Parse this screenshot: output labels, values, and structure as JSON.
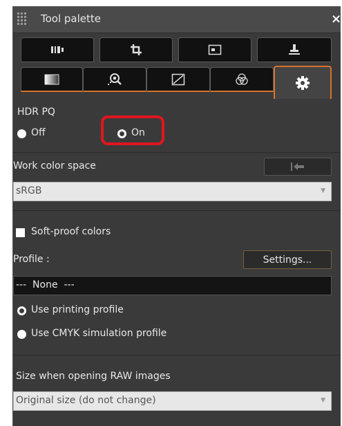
{
  "window": {
    "title": "Tool palette",
    "close_glyph": "×"
  },
  "tabs_row1": [
    {
      "icon": "histogram-panel-icon"
    },
    {
      "icon": "crop-icon"
    },
    {
      "icon": "image-view-icon"
    },
    {
      "icon": "stamp-icon"
    }
  ],
  "tabs_row2": [
    {
      "icon": "brightness-icon"
    },
    {
      "icon": "zoom-detail-icon"
    },
    {
      "icon": "tone-curve-icon"
    },
    {
      "icon": "color-circles-icon"
    },
    {
      "icon": "gear-icon",
      "active": true
    }
  ],
  "hdr": {
    "heading": "HDR PQ",
    "off_label": "Off",
    "on_label": "On",
    "selected": "on"
  },
  "work_color": {
    "label": "Work color space",
    "value": "sRGB",
    "reset_icon": "undo-arrow-icon"
  },
  "softproof": {
    "label": "Soft-proof colors",
    "profile_label": "Profile :",
    "settings_label": "Settings...",
    "profile_value": "---  None  ---"
  },
  "profile_options": {
    "printing_label": "Use printing profile",
    "cmyk_label": "Use CMYK simulation profile",
    "selected": "printing"
  },
  "raw_size": {
    "label": "Size when opening RAW images",
    "value": "Original size (do not change)"
  },
  "colors": {
    "accent": "#d8732a",
    "highlight": "#e0161e",
    "panel_bg": "#3a3a3a"
  }
}
